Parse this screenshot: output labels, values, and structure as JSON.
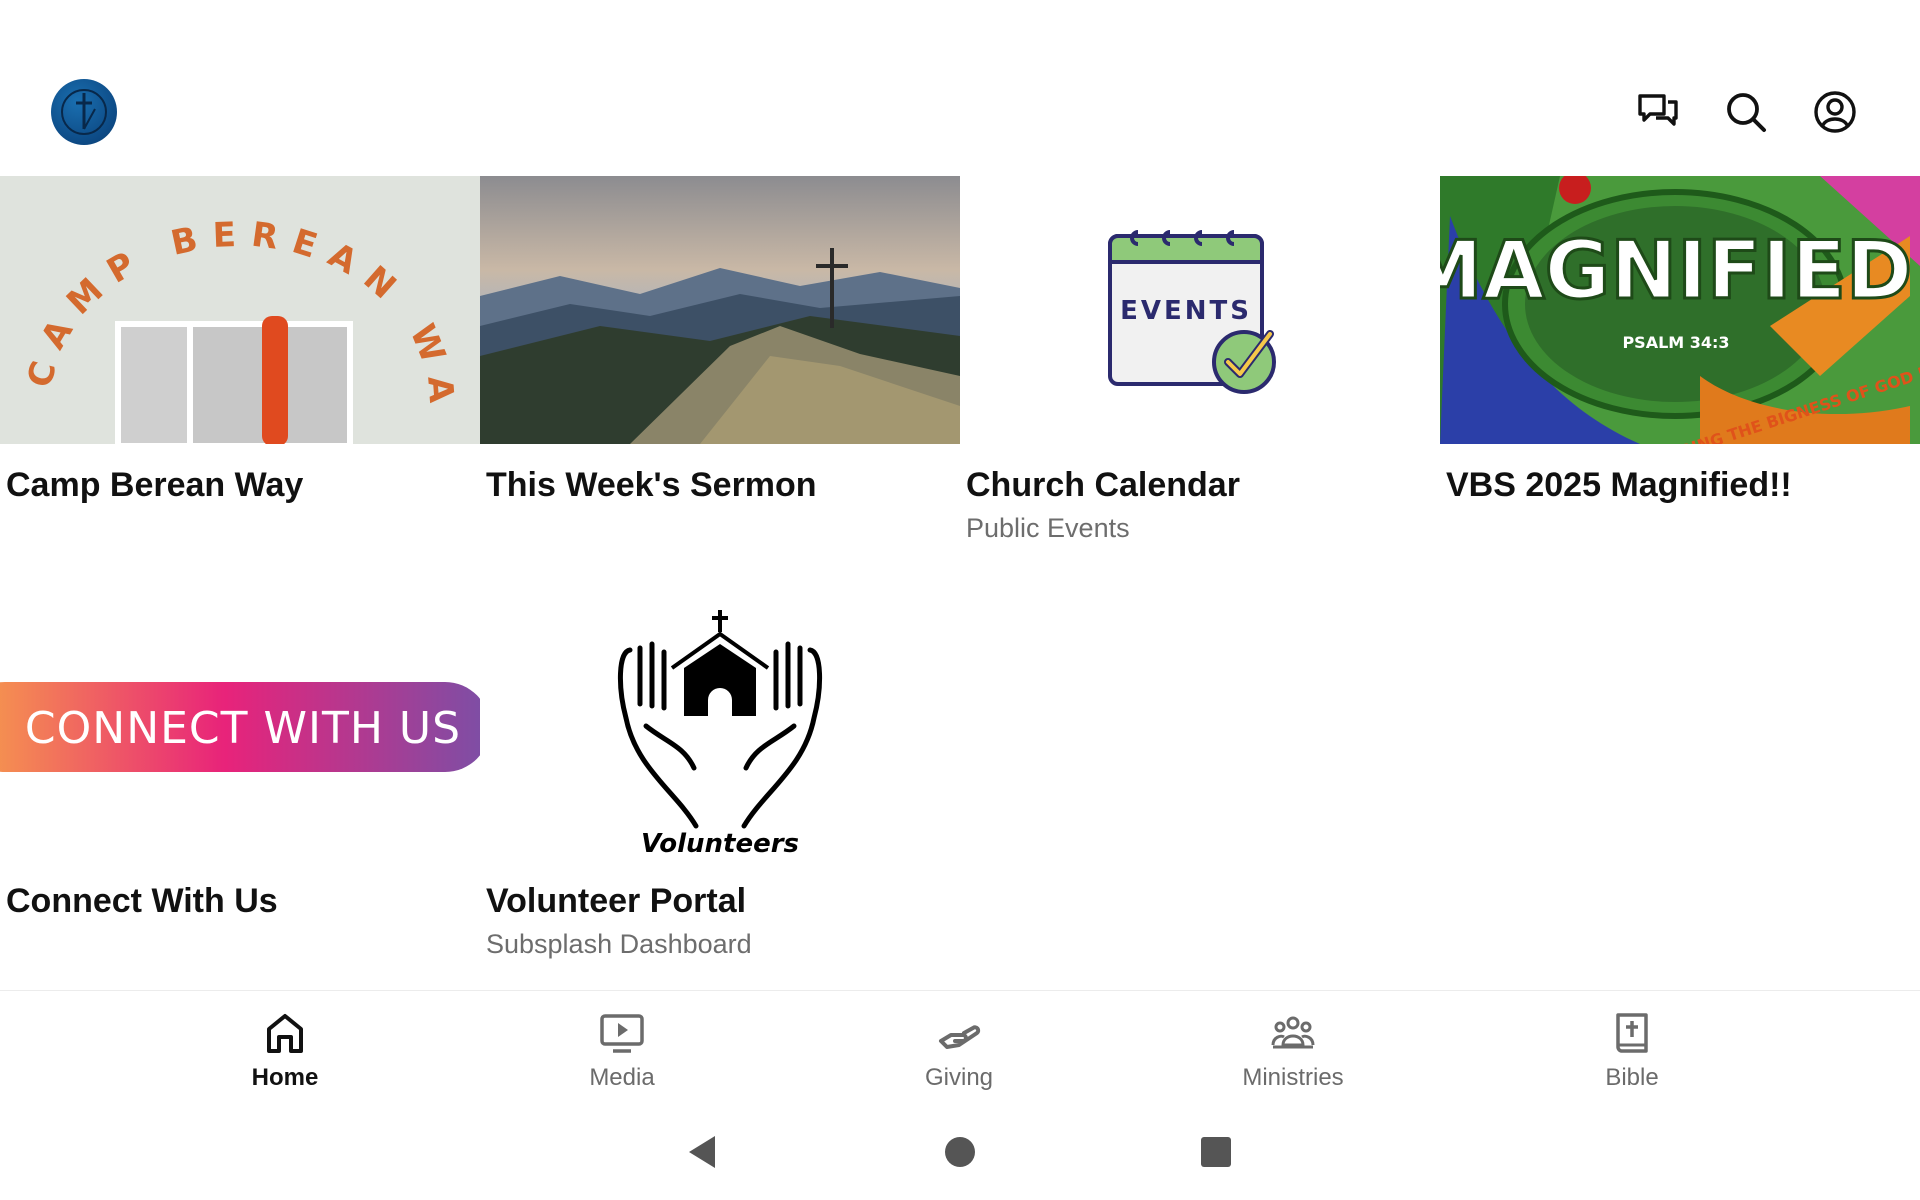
{
  "header": {
    "icons": [
      "logo",
      "chat-icon",
      "search-icon",
      "account-icon"
    ]
  },
  "tiles": [
    {
      "title": "Camp Berean Way",
      "subtitle": "",
      "image_text": "CAMP BEREAN WAY"
    },
    {
      "title": "This Week's Sermon",
      "subtitle": ""
    },
    {
      "title": "Church Calendar",
      "subtitle": "Public Events",
      "image_text": "EVENTS"
    },
    {
      "title": "VBS 2025 Magnified!!",
      "subtitle": "",
      "image_text": "MAGNIFIED!",
      "image_subtext": "PSALM 34:3",
      "image_tagline": "DISCOVERING THE BIGNESS OF GOD IN ALL THINGS"
    },
    {
      "title": "Connect With Us",
      "subtitle": "",
      "image_text": "CONNECT WITH US"
    },
    {
      "title": "Volunteer Portal",
      "subtitle": "Subsplash Dashboard",
      "image_text": "Volunteers"
    }
  ],
  "nav": {
    "items": [
      {
        "label": "Home",
        "icon": "home-icon",
        "active": true
      },
      {
        "label": "Media",
        "icon": "media-icon",
        "active": false
      },
      {
        "label": "Giving",
        "icon": "giving-icon",
        "active": false
      },
      {
        "label": "Ministries",
        "icon": "ministries-icon",
        "active": false
      },
      {
        "label": "Bible",
        "icon": "bible-icon",
        "active": false
      }
    ]
  },
  "colors": {
    "text": "#111111",
    "muted": "#6d6d6d",
    "logo_blue": "#0d4a85",
    "camp_orange": "#d46a2e",
    "events_green": "#8fc97a",
    "events_navy": "#2b2a6e",
    "connect_gradient": [
      "#f7a14a",
      "#e8237a",
      "#7b4fa6"
    ]
  }
}
